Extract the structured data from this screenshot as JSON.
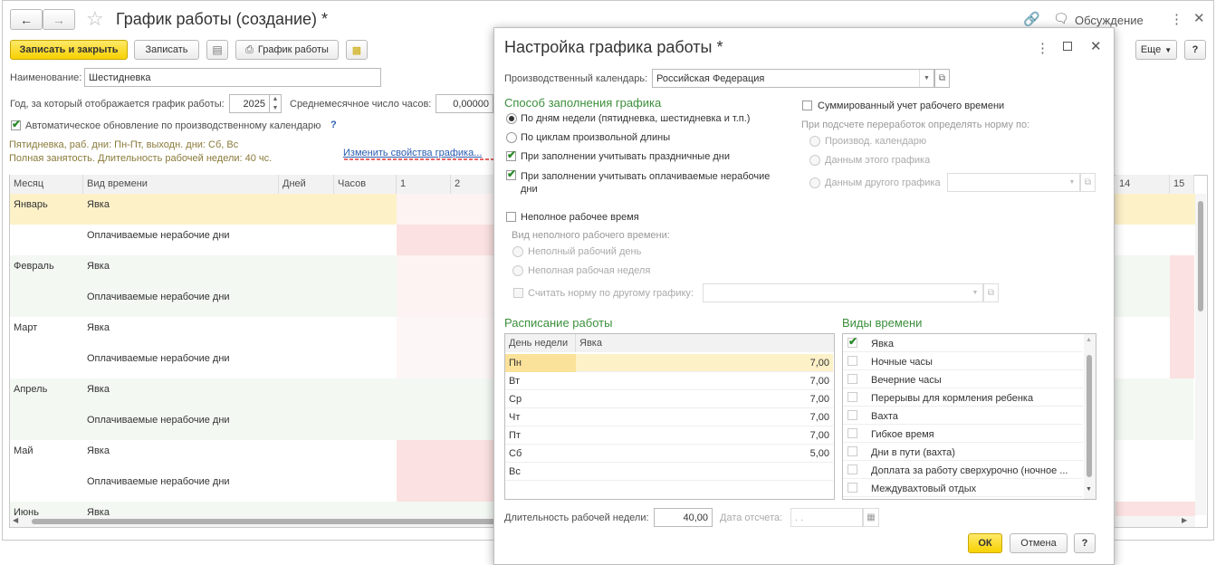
{
  "window": {
    "title": "График работы (создание) *",
    "discuss": "Обсуждение"
  },
  "toolbar": {
    "save_close": "Записать и закрыть",
    "save": "Записать",
    "schedule": "График работы",
    "more": "Еще",
    "help": "?"
  },
  "form": {
    "name_label": "Наименование:",
    "name_value": "Шестидневка",
    "year_label": "Год, за который отображается график работы:",
    "year_value": "2025",
    "avg_label": "Среднемесячное число часов:",
    "avg_value": "0,00000",
    "auto_update": "Автоматическое обновление по производственному календарю",
    "auto_update_help": "?",
    "info1": "Пятидневка, раб. дни: Пн-Пт, выходн. дни: Сб, Вс",
    "info2": "Полная занятость. Длительность рабочей недели: 40 чс.",
    "change_link": "Изменить свойства графика..."
  },
  "grid": {
    "headers": {
      "month": "Месяц",
      "type": "Вид времени",
      "days": "Дней",
      "hours": "Часов",
      "d1": "1",
      "d2": "2",
      "d14": "14",
      "d15": "15"
    },
    "rows": [
      {
        "month": "Январь",
        "type1": "Явка",
        "type2": "Оплачиваемые нерабочие дни"
      },
      {
        "month": "Февраль",
        "type1": "Явка",
        "type2": "Оплачиваемые нерабочие дни"
      },
      {
        "month": "Март",
        "type1": "Явка",
        "type2": "Оплачиваемые нерабочие дни"
      },
      {
        "month": "Апрель",
        "type1": "Явка",
        "type2": "Оплачиваемые нерабочие дни"
      },
      {
        "month": "Май",
        "type1": "Явка",
        "type2": "Оплачиваемые нерабочие дни"
      },
      {
        "month": "Июнь",
        "type1": "Явка",
        "type2": ""
      }
    ]
  },
  "dialog": {
    "title": "Настройка графика работы *",
    "calendar_label": "Производственный календарь:",
    "calendar_value": "Российская Федерация",
    "fill_header": "Способ заполнения графика",
    "fill_week": "По дням недели (пятидневка, шестидневка и т.п.)",
    "fill_cycle": "По циклам произвольной длины",
    "holidays": "При заполнении учитывать праздничные дни",
    "paid_nonwork": "При заполнении учитывать оплачиваемые нерабочие дни",
    "summ": "Суммированный учет рабочего времени",
    "norm_label": "При подсчете переработок определять норму по:",
    "norm_calendar": "Производ. календарю",
    "norm_this": "Данным этого графика",
    "norm_other": "Данным другого графика",
    "part_time": "Неполное рабочее время",
    "part_kind": "Вид неполного рабочего времени:",
    "part_day": "Неполный рабочий день",
    "part_week": "Неполная рабочая неделя",
    "other_norm": "Считать норму по другому графику:",
    "sched_header": "Расписание работы",
    "sched_col1": "День недели",
    "sched_col2": "Явка",
    "sched": [
      {
        "day": "Пн",
        "val": "7,00"
      },
      {
        "day": "Вт",
        "val": "7,00"
      },
      {
        "day": "Ср",
        "val": "7,00"
      },
      {
        "day": "Чт",
        "val": "7,00"
      },
      {
        "day": "Пт",
        "val": "7,00"
      },
      {
        "day": "Сб",
        "val": "5,00"
      },
      {
        "day": "Вс",
        "val": ""
      }
    ],
    "types_header": "Виды времени",
    "types": [
      "Явка",
      "Ночные часы",
      "Вечерние часы",
      "Перерывы для кормления ребенка",
      "Вахта",
      "Гибкое время",
      "Дни в пути (вахта)",
      "Доплата за работу сверхурочно (ночное ...",
      "Междувахтовый отдых"
    ],
    "week_len_label": "Длительность рабочей недели:",
    "week_len_value": "40,00",
    "ref_date_label": "Дата отсчета:",
    "ref_date_value": ". .",
    "ok": "ОК",
    "cancel": "Отмена",
    "help": "?"
  },
  "colors": {
    "accent_yellow": "#f7d100",
    "row_highlight": "#fdf1c8",
    "pink": "#fbe1e1",
    "green": "#3b8f3b",
    "link": "#2a5db0"
  }
}
